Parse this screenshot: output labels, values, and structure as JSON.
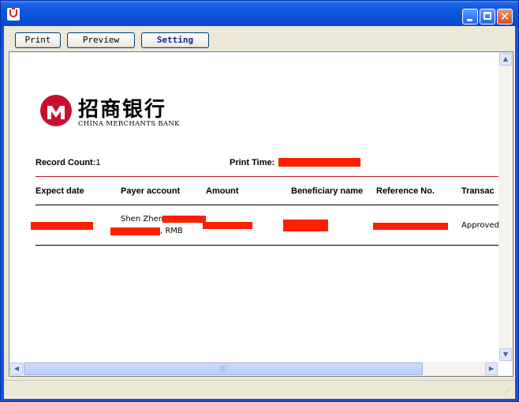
{
  "window": {
    "icon": "app-icon",
    "controls": {
      "minimize": "minimize-icon",
      "maximize": "maximize-icon",
      "close": "✕"
    }
  },
  "toolbar": {
    "print_label": "Print",
    "preview_label": "Preview",
    "setting_label": "Setting"
  },
  "report": {
    "logo_cn": "招商银行",
    "logo_en": "CHINA MERCHANTS BANK",
    "record_count_label": "Record Count:",
    "record_count_value": "1",
    "print_time_label": "Print Time:",
    "columns": [
      "Expect date",
      "Payer account",
      "Amount",
      "Beneficiary name",
      "Reference No.",
      "Transac"
    ],
    "row": {
      "payer_line1": "Shen Zhen,",
      "payer_line2": ", RMB",
      "status": "Approved"
    }
  },
  "colors": {
    "brand_red": "#c8102e",
    "redaction": "#ff1e00",
    "titlebar_blue": "#0a55df"
  }
}
